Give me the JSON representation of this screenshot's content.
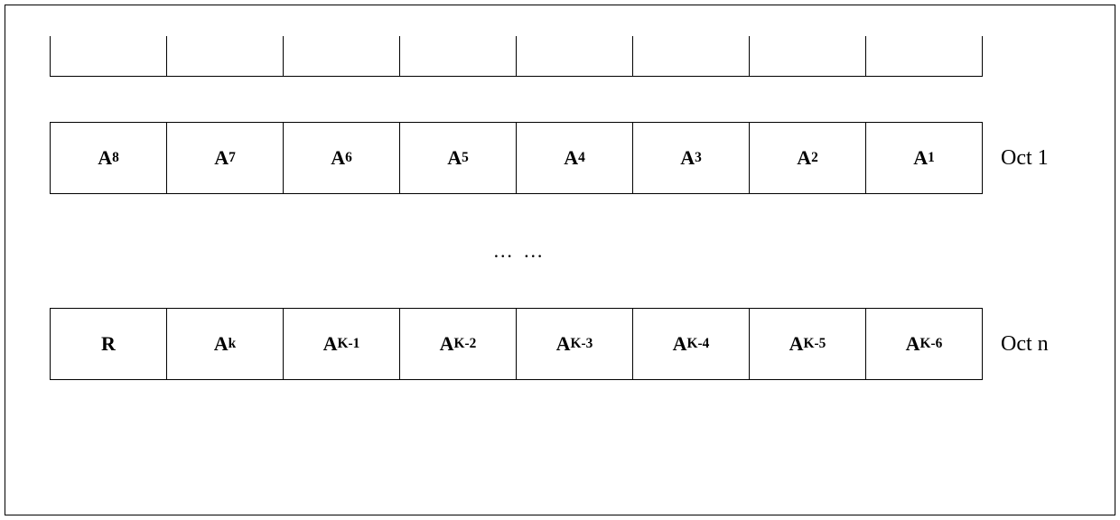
{
  "rows": {
    "row1": {
      "label": "Oct 1",
      "cells": [
        {
          "base": "A",
          "sub": "8"
        },
        {
          "base": "A",
          "sub": "7"
        },
        {
          "base": "A",
          "sub": "6"
        },
        {
          "base": "A",
          "sub": "5"
        },
        {
          "base": "A",
          "sub": "4"
        },
        {
          "base": "A",
          "sub": "3"
        },
        {
          "base": "A",
          "sub": "2"
        },
        {
          "base": "A",
          "sub": "1"
        }
      ]
    },
    "ellipsis": "… …",
    "rowN": {
      "label": "Oct n",
      "cells": [
        {
          "base": "R",
          "sub": ""
        },
        {
          "base": "A",
          "sub": "k"
        },
        {
          "base": "A",
          "sub": "K-1"
        },
        {
          "base": "A",
          "sub": "K-2"
        },
        {
          "base": "A",
          "sub": "K-3"
        },
        {
          "base": "A",
          "sub": "K-4"
        },
        {
          "base": "A",
          "sub": "K-5"
        },
        {
          "base": "A",
          "sub": "K-6"
        }
      ]
    }
  }
}
